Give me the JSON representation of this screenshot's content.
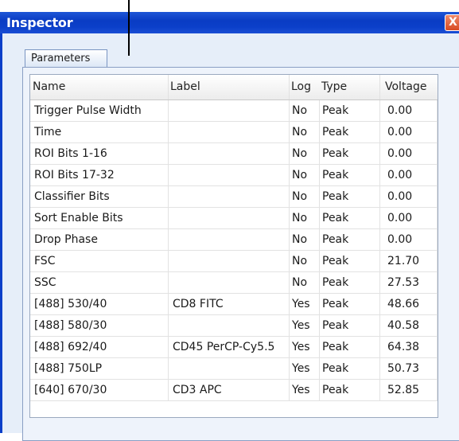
{
  "window": {
    "title": "Inspector",
    "close_glyph": "X"
  },
  "tabs": [
    {
      "label": "Parameters"
    }
  ],
  "table": {
    "columns": [
      "Name",
      "Label",
      "Log",
      "Type",
      "Voltage"
    ],
    "rows": [
      {
        "name": "Trigger Pulse Width",
        "label": "",
        "log": "No",
        "type": "Peak",
        "voltage": "0.00"
      },
      {
        "name": "Time",
        "label": "",
        "log": "No",
        "type": "Peak",
        "voltage": "0.00"
      },
      {
        "name": "ROI Bits 1-16",
        "label": "",
        "log": "No",
        "type": "Peak",
        "voltage": "0.00"
      },
      {
        "name": "ROI Bits 17-32",
        "label": "",
        "log": "No",
        "type": "Peak",
        "voltage": "0.00"
      },
      {
        "name": "Classifier Bits",
        "label": "",
        "log": "No",
        "type": "Peak",
        "voltage": "0.00"
      },
      {
        "name": "Sort Enable Bits",
        "label": "",
        "log": "No",
        "type": "Peak",
        "voltage": "0.00"
      },
      {
        "name": "Drop Phase",
        "label": "",
        "log": "No",
        "type": "Peak",
        "voltage": "0.00"
      },
      {
        "name": "FSC",
        "label": "",
        "log": "No",
        "type": "Peak",
        "voltage": "21.70"
      },
      {
        "name": "SSC",
        "label": "",
        "log": "No",
        "type": "Peak",
        "voltage": "27.53"
      },
      {
        "name": "[488] 530/40",
        "label": "CD8 FITC",
        "log": "Yes",
        "type": "Peak",
        "voltage": "48.66"
      },
      {
        "name": "[488] 580/30",
        "label": "",
        "log": "Yes",
        "type": "Peak",
        "voltage": "40.58"
      },
      {
        "name": "[488] 692/40",
        "label": "CD45 PerCP-Cy5.5",
        "log": "Yes",
        "type": "Peak",
        "voltage": "64.38"
      },
      {
        "name": "[488] 750LP",
        "label": "",
        "log": "Yes",
        "type": "Peak",
        "voltage": "50.73"
      },
      {
        "name": "[640] 670/30",
        "label": "CD3 APC",
        "log": "Yes",
        "type": "Peak",
        "voltage": "52.85"
      }
    ]
  },
  "colors": {
    "titlebar": "#0b3fc9",
    "close": "#d84a22"
  }
}
